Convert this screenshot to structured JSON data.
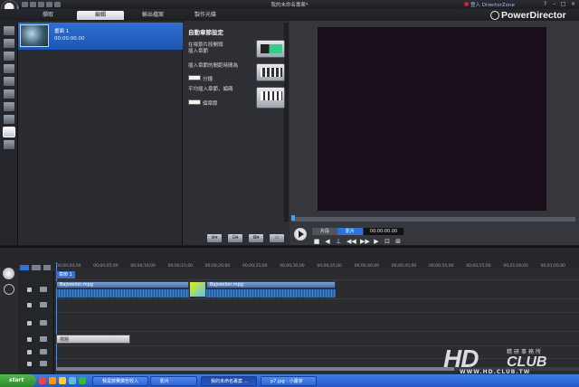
{
  "window": {
    "title": "我的未命名專案*",
    "user_link": "登入 DirectorZone",
    "brand": "PowerDirector",
    "controls": [
      "?",
      "–",
      "□",
      "×"
    ]
  },
  "mode_tabs": [
    {
      "label": "擷取",
      "active": false
    },
    {
      "label": "編輯",
      "active": true
    },
    {
      "label": "輸出檔案",
      "active": false
    },
    {
      "label": "製作光碟",
      "active": false
    }
  ],
  "tools": [
    "media-room",
    "effect-room",
    "pip-room",
    "particle-room",
    "title-room",
    "transition-room",
    "audio-mixing-room",
    "voice-over-room",
    "chapter-room",
    "subtitle-room",
    "slideshow-room"
  ],
  "library": {
    "item_name": "畫面 1",
    "item_duration": "00:00:00.00"
  },
  "wizard": {
    "title": "自動章節設定",
    "opt1": "在場景片段開頭\n插入章節",
    "opt2": "插入章節的間距時間為",
    "opt2_unit": "分鐘",
    "opt3": "平均插入章節，編碼",
    "opt3_unit": "個章節",
    "footer_buttons": [
      "⊕▾",
      "⊟▾",
      "⊠▾",
      "▭"
    ]
  },
  "preview": {
    "mode_clip": "片段",
    "mode_movie": "影片",
    "timecode": "00:00:00.00",
    "controls": [
      "■",
      "◀",
      "⊥",
      "◀◀",
      "▶▶",
      "▶",
      "⊡",
      "⊞"
    ]
  },
  "timeline": {
    "ruler_ticks": [
      "00;00;00;00",
      "00;00;05;00",
      "00;00;10;00",
      "00;00;15;00",
      "00;00;20;00",
      "00;00;25;00",
      "00;00;30;00",
      "00;00;35;00",
      "00;00;40;00",
      "00;00;45;00",
      "00;00;50;00",
      "00;00;55;00",
      "00;01;00;00",
      "00;01;05;00"
    ],
    "marker_label": "章節 1",
    "clip_a": "Bajvesion.mpg",
    "clip_b": "Bajvesion.mpg",
    "title_clip": "標題"
  },
  "taskbar": {
    "start": "start",
    "items": [
      {
        "label": "我是旅費廣告收入",
        "active": false
      },
      {
        "label": "影片",
        "active": false
      },
      {
        "label": "我的未命名專案 ...",
        "active": true
      },
      {
        "label": "p7.jpg - 小畫家",
        "active": false
      }
    ]
  },
  "watermark": {
    "hd": "HD",
    "club": "CLUB",
    "cn": "精研事務所",
    "url": "WWW.HD.CLUB.TW"
  },
  "colors": {
    "accent": "#2e74d8",
    "panel": "#2a2c31",
    "preview_black": "#1a0f1b",
    "taskbar": "#2357c7"
  }
}
